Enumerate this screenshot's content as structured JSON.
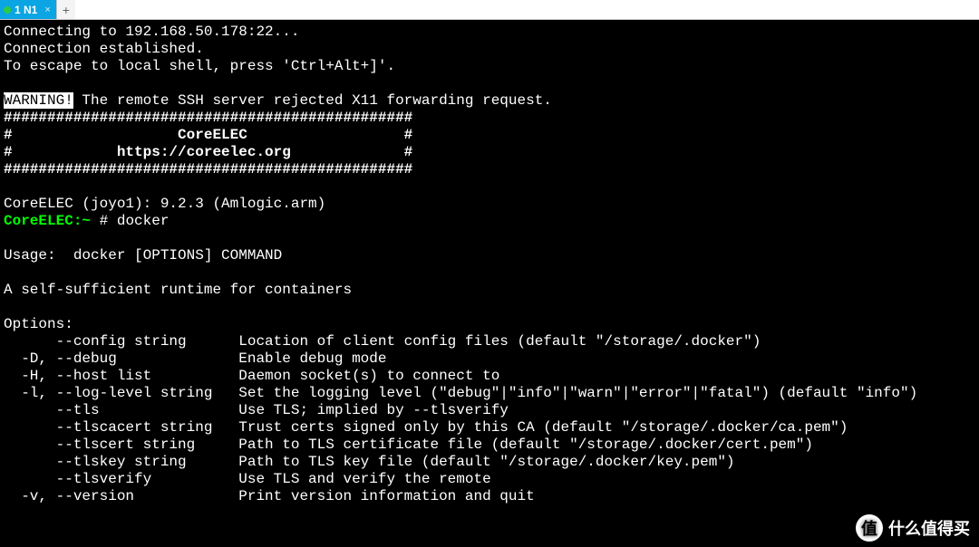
{
  "tabs": {
    "active": {
      "label": "1 N1",
      "close_glyph": "×"
    },
    "add_glyph": "+"
  },
  "term": {
    "connecting": "Connecting to 192.168.50.178:22...",
    "established": "Connection established.",
    "escape": "To escape to local shell, press 'Ctrl+Alt+]'.",
    "warning_label": "WARNING!",
    "warning_rest": " The remote SSH server rejected X11 forwarding request.",
    "banner_border": "###############################################",
    "banner_name": "#                   CoreELEC                  #",
    "banner_url": "#            https://coreelec.org             #",
    "version_line": "CoreELEC (joyo1): 9.2.3 (Amlogic.arm)",
    "prompt_host": "CoreELEC:",
    "prompt_path": "~",
    "prompt_rest": " # docker",
    "usage": "Usage:  docker [OPTIONS] COMMAND",
    "desc": "A self-sufficient runtime for containers",
    "options_header": "Options:",
    "opts": {
      "config": "      --config string      Location of client config files (default \"/storage/.docker\")",
      "debug": "  -D, --debug              Enable debug mode",
      "host": "  -H, --host list          Daemon socket(s) to connect to",
      "loglevel": "  -l, --log-level string   Set the logging level (\"debug\"|\"info\"|\"warn\"|\"error\"|\"fatal\") (default \"info\")",
      "tls": "      --tls                Use TLS; implied by --tlsverify",
      "tlscacert": "      --tlscacert string   Trust certs signed only by this CA (default \"/storage/.docker/ca.pem\")",
      "tlscert": "      --tlscert string     Path to TLS certificate file (default \"/storage/.docker/cert.pem\")",
      "tlskey": "      --tlskey string      Path to TLS key file (default \"/storage/.docker/key.pem\")",
      "tlsverify": "      --tlsverify          Use TLS and verify the remote",
      "version": "  -v, --version            Print version information and quit"
    }
  },
  "watermark": {
    "badge": "值",
    "text": "什么值得买"
  }
}
